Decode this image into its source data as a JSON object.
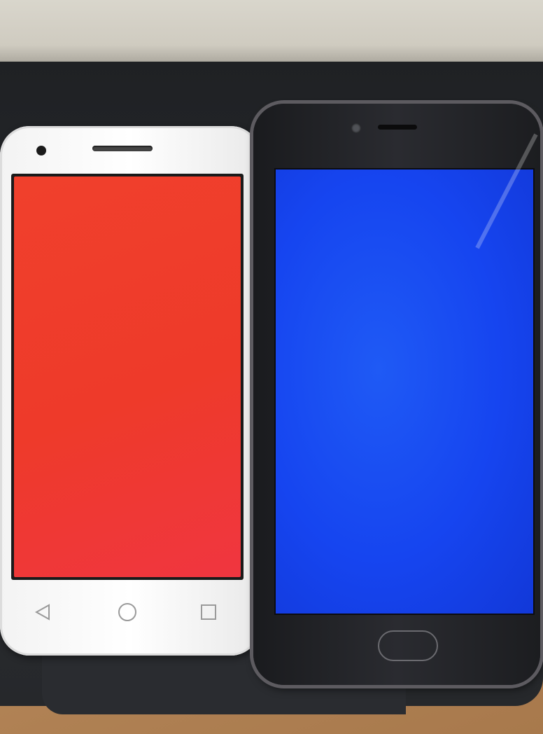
{
  "scene": {
    "description_colors": {
      "left_screen_color": "#f0402c",
      "right_screen_color": "#1645f0",
      "white_phone_body": "#f5f5f5",
      "dark_phone_body": "#222326"
    }
  },
  "left_phone": {
    "nav_icons": [
      "back-triangle-icon",
      "home-circle-icon",
      "recents-square-icon"
    ]
  },
  "right_phone": {
    "home_key": "fingerprint-home-button"
  }
}
